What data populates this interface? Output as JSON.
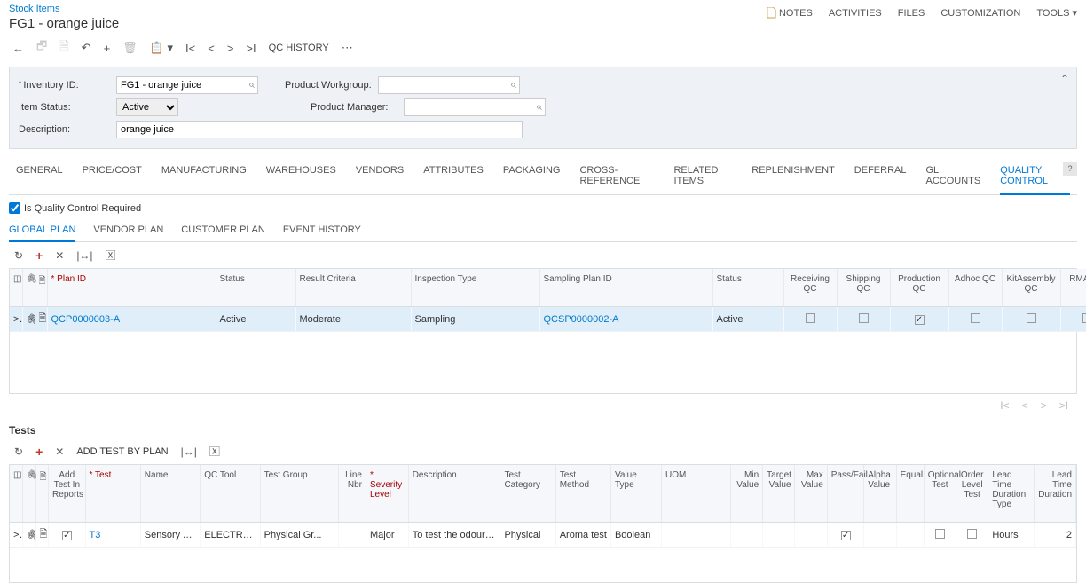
{
  "breadcrumb": "Stock Items",
  "title": "FG1 - orange juice",
  "top_links": {
    "notes": "NOTES",
    "activities": "ACTIVITIES",
    "files": "FILES",
    "customization": "CUSTOMIZATION",
    "tools": "TOOLS"
  },
  "toolbar": {
    "qc_history": "QC HISTORY"
  },
  "form": {
    "inventory_id_label": "Inventory ID:",
    "inventory_id_value": "FG1 - orange juice",
    "item_status_label": "Item Status:",
    "item_status_value": "Active",
    "description_label": "Description:",
    "description_value": "orange juice",
    "product_workgroup_label": "Product Workgroup:",
    "product_workgroup_value": "",
    "product_manager_label": "Product Manager:",
    "product_manager_value": ""
  },
  "tabs": [
    "GENERAL",
    "PRICE/COST",
    "MANUFACTURING",
    "WAREHOUSES",
    "VENDORS",
    "ATTRIBUTES",
    "PACKAGING",
    "CROSS-REFERENCE",
    "RELATED ITEMS",
    "REPLENISHMENT",
    "DEFERRAL",
    "GL ACCOUNTS",
    "QUALITY CONTROL"
  ],
  "active_tab": "QUALITY CONTROL",
  "qc_required_label": "Is Quality Control Required",
  "subtabs": [
    "GLOBAL PLAN",
    "VENDOR PLAN",
    "CUSTOMER PLAN",
    "EVENT HISTORY"
  ],
  "active_subtab": "GLOBAL PLAN",
  "plan_grid": {
    "headers": {
      "plan_id": "Plan ID",
      "status": "Status",
      "result_criteria": "Result Criteria",
      "inspection_type": "Inspection Type",
      "sampling_plan": "Sampling Plan ID",
      "status2": "Status",
      "receiving": "Receiving QC",
      "shipping": "Shipping QC",
      "production": "Production QC",
      "adhoc": "Adhoc QC",
      "kitassembly": "KitAssembly QC",
      "rma": "RMA QC"
    },
    "rows": [
      {
        "plan_id": "QCP0000003-A",
        "status": "Active",
        "result_criteria": "Moderate",
        "inspection_type": "Sampling",
        "sampling_plan": "QCSP0000002-A",
        "status2": "Active",
        "receiving": false,
        "shipping": false,
        "production": true,
        "adhoc": false,
        "kitassembly": false,
        "rma": false
      }
    ]
  },
  "tests_title": "Tests",
  "tests_toolbar": {
    "add_by_plan": "ADD TEST BY PLAN"
  },
  "tests_grid": {
    "headers": {
      "add_test": "Add Test In Reports",
      "test": "Test",
      "name": "Name",
      "qc_tool": "QC Tool",
      "test_group": "Test Group",
      "line_nbr": "Line Nbr",
      "severity": "Severity Level",
      "description": "Description",
      "test_category": "Test Category",
      "test_method": "Test Method",
      "value_type": "Value Type",
      "uom": "UOM",
      "min": "Min Value",
      "target": "Target Value",
      "max": "Max Value",
      "passfail": "Pass/Fail",
      "alpha": "Alpha Value",
      "equal": "Equal",
      "optional": "Optional Test",
      "order_level": "Order Level Test",
      "lead_dur_type": "Lead Time Duration Type",
      "lead_dur": "Lead Time Duration"
    },
    "rows": [
      {
        "add_test": true,
        "test": "T3",
        "name": "Sensory An...",
        "qc_tool": "ELECTRO...",
        "test_group": "Physical Gr...",
        "line_nbr": "",
        "severity": "Major",
        "description": "To test the odour of t...",
        "test_category": "Physical",
        "test_method": "Aroma test",
        "value_type": "Boolean",
        "uom": "",
        "min": "",
        "target": "",
        "max": "",
        "passfail": true,
        "alpha": "",
        "equal": "",
        "optional": false,
        "order_level": false,
        "lead_dur_type": "Hours",
        "lead_dur": "2"
      }
    ]
  }
}
